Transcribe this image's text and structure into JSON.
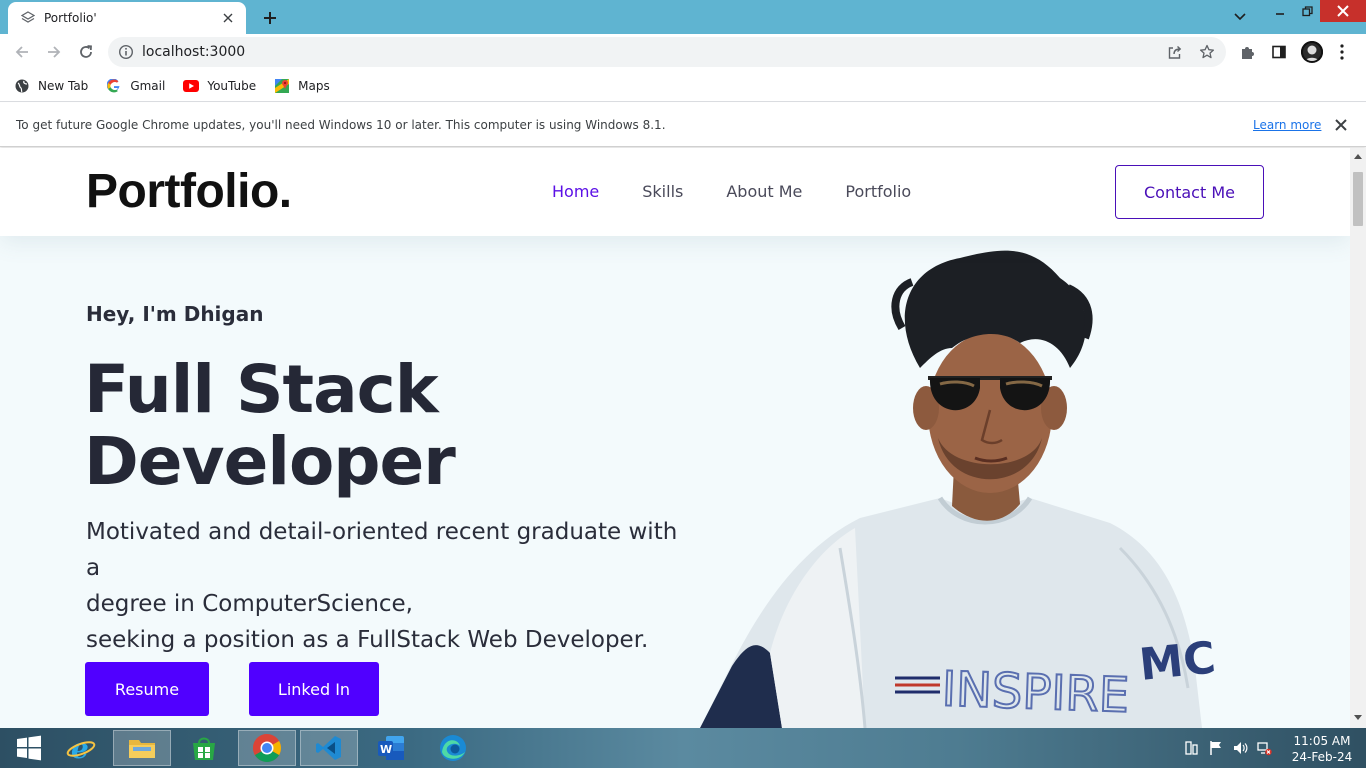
{
  "browser": {
    "tab_title": "Portfolio'",
    "url": "localhost:3000",
    "bookmarks": [
      {
        "label": "New Tab",
        "icon": "globe-icon"
      },
      {
        "label": "Gmail",
        "icon": "google-icon"
      },
      {
        "label": "YouTube",
        "icon": "youtube-icon"
      },
      {
        "label": "Maps",
        "icon": "maps-icon"
      }
    ],
    "infobar": {
      "message": "To get future Google Chrome updates, you'll need Windows 10 or later. This computer is using Windows 8.1.",
      "link": "Learn more"
    },
    "frame_color": "#5fb4d1"
  },
  "site": {
    "logo": "Portfolio.",
    "nav": [
      "Home",
      "Skills",
      "About Me",
      "Portfolio"
    ],
    "active_nav": "Home",
    "contact_button": "Contact Me",
    "greeting": "Hey, I'm Dhigan",
    "headline_line1": "Full Stack",
    "headline_line2": "Developer",
    "bio_line1": "Motivated and detail-oriented recent graduate with a",
    "bio_line2": "degree in ComputerScience,",
    "bio_line3": "seeking a position as a FullStack Web Developer.",
    "resume_button": "Resume",
    "linkedin_button": "Linked In",
    "accent_color": "#5000ff",
    "shirt_text_1": "INSPIRE",
    "shirt_text_2": "MC"
  },
  "taskbar": {
    "apps": [
      "windows-start-icon",
      "internet-explorer-icon",
      "file-explorer-icon",
      "store-icon",
      "chrome-icon",
      "vscode-icon",
      "word-icon",
      "edge-icon"
    ],
    "time": "11:05 AM",
    "date": "24-Feb-24"
  }
}
